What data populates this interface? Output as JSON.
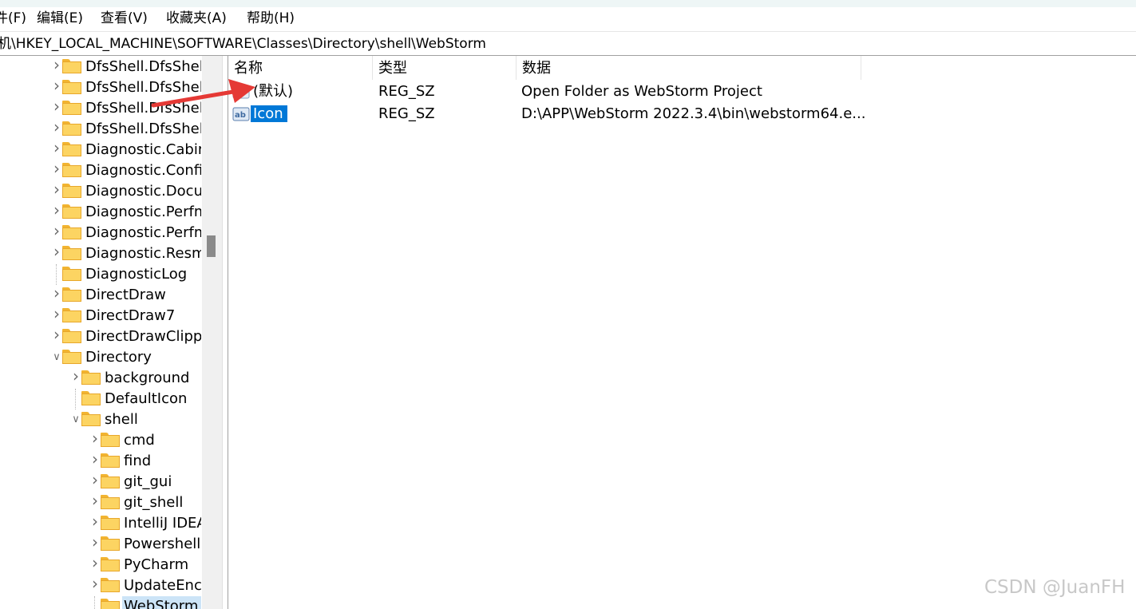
{
  "menu": {
    "items": [
      "件(F)",
      "编辑(E)",
      "查看(V)",
      "收藏夹(A)",
      "帮助(H)"
    ]
  },
  "address": {
    "path": "机\\HKEY_LOCAL_MACHINE\\SOFTWARE\\Classes\\Directory\\shell\\WebStorm"
  },
  "tree": {
    "items": [
      {
        "label": "DfsShell.DfsShell",
        "level": 0,
        "chevron": "collapsed"
      },
      {
        "label": "DfsShell.DfsShell",
        "level": 0,
        "chevron": "collapsed"
      },
      {
        "label": "DfsShell.DfsShell",
        "level": 0,
        "chevron": "collapsed"
      },
      {
        "label": "DfsShell.DfsShell",
        "level": 0,
        "chevron": "collapsed"
      },
      {
        "label": "Diagnostic.Cabir",
        "level": 0,
        "chevron": "collapsed"
      },
      {
        "label": "Diagnostic.Confi",
        "level": 0,
        "chevron": "collapsed"
      },
      {
        "label": "Diagnostic.Docu",
        "level": 0,
        "chevron": "collapsed"
      },
      {
        "label": "Diagnostic.Perfm",
        "level": 0,
        "chevron": "collapsed"
      },
      {
        "label": "Diagnostic.Perfm",
        "level": 0,
        "chevron": "collapsed"
      },
      {
        "label": "Diagnostic.Resm",
        "level": 0,
        "chevron": "collapsed"
      },
      {
        "label": "DiagnosticLog",
        "level": 0,
        "chevron": "none"
      },
      {
        "label": "DirectDraw",
        "level": 0,
        "chevron": "collapsed"
      },
      {
        "label": "DirectDraw7",
        "level": 0,
        "chevron": "collapsed"
      },
      {
        "label": "DirectDrawClipp",
        "level": 0,
        "chevron": "collapsed"
      },
      {
        "label": "Directory",
        "level": 0,
        "chevron": "expanded"
      },
      {
        "label": "background",
        "level": 1,
        "chevron": "collapsed"
      },
      {
        "label": "DefaultIcon",
        "level": 1,
        "chevron": "none"
      },
      {
        "label": "shell",
        "level": 1,
        "chevron": "expanded"
      },
      {
        "label": "cmd",
        "level": 2,
        "chevron": "collapsed"
      },
      {
        "label": "find",
        "level": 2,
        "chevron": "collapsed"
      },
      {
        "label": "git_gui",
        "level": 2,
        "chevron": "collapsed"
      },
      {
        "label": "git_shell",
        "level": 2,
        "chevron": "collapsed"
      },
      {
        "label": "IntelliJ IDEA",
        "level": 2,
        "chevron": "collapsed"
      },
      {
        "label": "Powershell",
        "level": 2,
        "chevron": "collapsed"
      },
      {
        "label": "PyCharm",
        "level": 2,
        "chevron": "collapsed"
      },
      {
        "label": "UpdateEnc",
        "level": 2,
        "chevron": "collapsed"
      },
      {
        "label": "WebStorm",
        "level": 2,
        "chevron": "none",
        "selected": true
      }
    ]
  },
  "list": {
    "headers": [
      "名称",
      "类型",
      "数据"
    ],
    "rows": [
      {
        "name": "(默认)",
        "type": "REG_SZ",
        "data": "Open Folder as WebStorm Project",
        "selected": false
      },
      {
        "name": "Icon",
        "type": "REG_SZ",
        "data": "D:\\APP\\WebStorm 2022.3.4\\bin\\webstorm64.e...",
        "selected": true
      }
    ]
  },
  "annotation": {
    "arrow_color": "#e53935"
  },
  "colors": {
    "selection": "#0078d7",
    "tree_selection": "#cce4f7",
    "folder": "#fcd462"
  },
  "watermark": "CSDN @JuanFH"
}
